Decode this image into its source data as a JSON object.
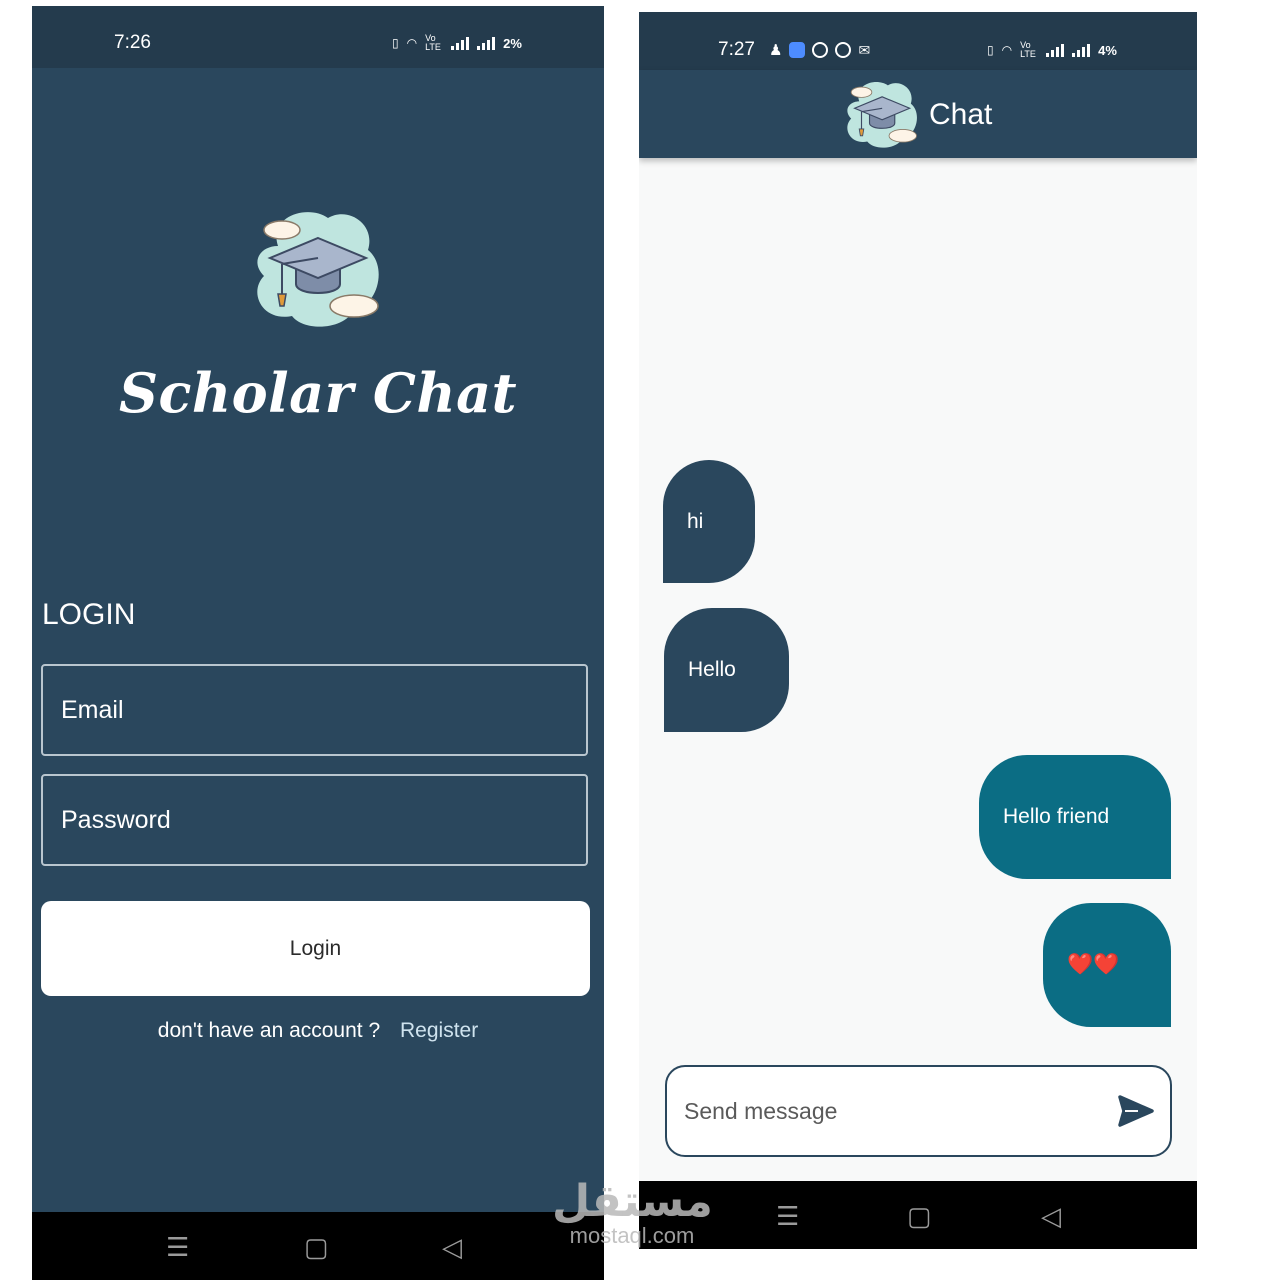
{
  "login_screen": {
    "status_bar": {
      "time": "7:26",
      "battery": "2%",
      "net_label": "Vo LTE"
    },
    "app_title": "Scholar Chat",
    "heading": "LOGIN",
    "email_placeholder": "Email",
    "password_placeholder": "Password",
    "login_button": "Login",
    "no_account_text": "don't have an account ?",
    "register_link": "Register",
    "nav": {
      "menu": "☰",
      "home": "▢",
      "back": "◁"
    }
  },
  "chat_screen": {
    "status_bar": {
      "time": "7:27",
      "battery": "4%",
      "net_label": "Vo LTE"
    },
    "title": "Chat",
    "messages": [
      {
        "text": "hi",
        "direction": "received"
      },
      {
        "text": "Hello",
        "direction": "received"
      },
      {
        "text": "Hello friend",
        "direction": "sent"
      },
      {
        "text": "❤️❤️",
        "direction": "sent"
      }
    ],
    "input_placeholder": "Send message",
    "nav": {
      "menu": "☰",
      "home": "▢",
      "back": "◁"
    }
  },
  "watermark": {
    "arabic": "مستقل",
    "latin": "mostaql.com"
  },
  "colors": {
    "primary": "#2a475d",
    "sent_bubble": "#0b6d84",
    "chat_background": "#f8f9f9",
    "button_background": "#ffffff"
  },
  "icons": [
    "graduation-cap-logo",
    "send-icon",
    "menu-icon",
    "home-icon",
    "back-icon",
    "wifi-icon",
    "signal-icon",
    "vibrate-icon"
  ]
}
